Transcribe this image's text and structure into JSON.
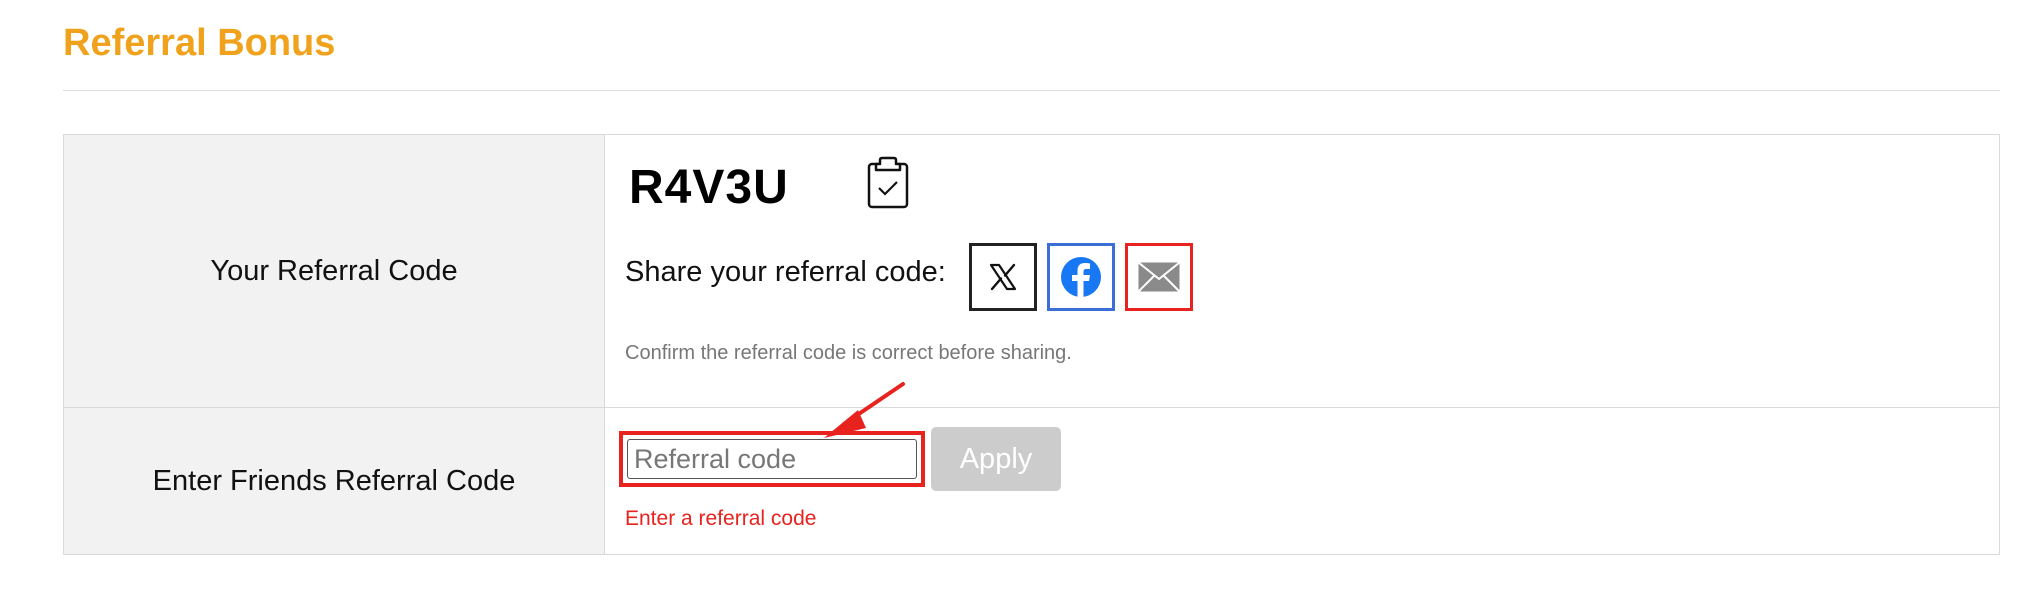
{
  "page": {
    "title": "Referral Bonus",
    "accent_color": "#f0a21c"
  },
  "referral": {
    "your_code_label": "Your Referral Code",
    "code": "R4V3U",
    "copy_icon": "clipboard-check-icon",
    "share_label": "Share your referral code:",
    "share_buttons": [
      {
        "name": "x-share",
        "icon": "x-logo-icon",
        "color": "#222222"
      },
      {
        "name": "facebook-share",
        "icon": "facebook-logo-icon",
        "color": "#1877f2"
      },
      {
        "name": "email-share",
        "icon": "envelope-icon",
        "color": "#e8231f"
      }
    ],
    "hint": "Confirm the referral code is correct before sharing."
  },
  "friend_code": {
    "label": "Enter Friends Referral Code",
    "input_value": "",
    "input_placeholder": "Referral code",
    "apply_label": "Apply",
    "error": "Enter a referral code",
    "error_color": "#e8231f"
  }
}
